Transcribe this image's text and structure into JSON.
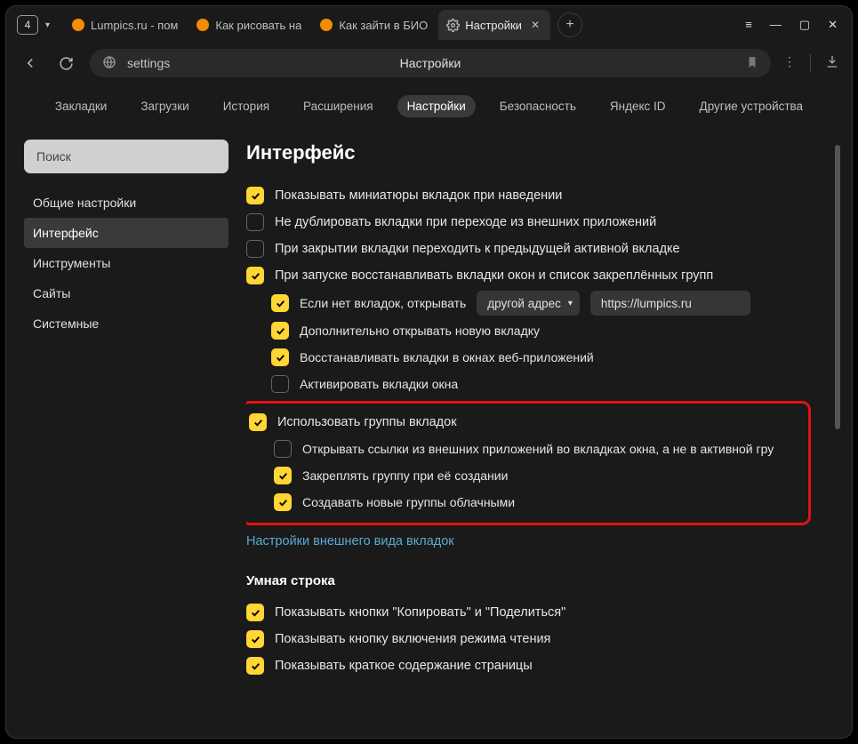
{
  "titlebar": {
    "tab_count": "4",
    "tabs": [
      {
        "label": "Lumpics.ru - пом",
        "icon": "orange"
      },
      {
        "label": "Как рисовать на",
        "icon": "orange"
      },
      {
        "label": "Как зайти в БИО",
        "icon": "orange"
      },
      {
        "label": "Настройки",
        "icon": "gear",
        "active": true
      }
    ]
  },
  "address": {
    "text": "settings",
    "title": "Настройки"
  },
  "topnav": [
    "Закладки",
    "Загрузки",
    "История",
    "Расширения",
    "Настройки",
    "Безопасность",
    "Яндекс ID",
    "Другие устройства"
  ],
  "topnav_active": 4,
  "sidebar": {
    "search_placeholder": "Поиск",
    "items": [
      "Общие настройки",
      "Интерфейс",
      "Инструменты",
      "Сайты",
      "Системные"
    ],
    "active": 1
  },
  "section": {
    "title": "Интерфейс",
    "rows": [
      {
        "checked": true,
        "label": "Показывать миниатюры вкладок при наведении"
      },
      {
        "checked": false,
        "label": "Не дублировать вкладки при переходе из внешних приложений"
      },
      {
        "checked": false,
        "label": "При закрытии вкладки переходить к предыдущей активной вкладке"
      },
      {
        "checked": true,
        "label": "При запуске восстанавливать вкладки окон и список закреплённых групп"
      }
    ],
    "sub_no_tabs": {
      "checked": true,
      "label": "Если нет вкладок, открывать",
      "option": "другой адрес",
      "url": "https://lumpics.ru"
    },
    "sub_rows1": [
      {
        "checked": true,
        "label": "Дополнительно открывать новую вкладку"
      },
      {
        "checked": true,
        "label": "Восстанавливать вкладки в окнах веб-приложений"
      },
      {
        "checked": false,
        "label": "Активировать вкладки окна"
      }
    ],
    "highlight_head": {
      "checked": true,
      "label": "Использовать группы вкладок"
    },
    "highlight_rows": [
      {
        "checked": false,
        "label": "Открывать ссылки из внешних приложений во вкладках окна, а не в активной гру"
      },
      {
        "checked": true,
        "label": "Закреплять группу при её создании"
      },
      {
        "checked": true,
        "label": "Создавать новые группы облачными"
      }
    ],
    "link": "Настройки внешнего вида вкладок",
    "sub_section_title": "Умная строка",
    "smart_rows": [
      {
        "checked": true,
        "label": "Показывать кнопки \"Копировать\" и \"Поделиться\""
      },
      {
        "checked": true,
        "label": "Показывать кнопку включения режима чтения"
      },
      {
        "checked": true,
        "label": "Показывать краткое содержание страницы"
      }
    ]
  }
}
